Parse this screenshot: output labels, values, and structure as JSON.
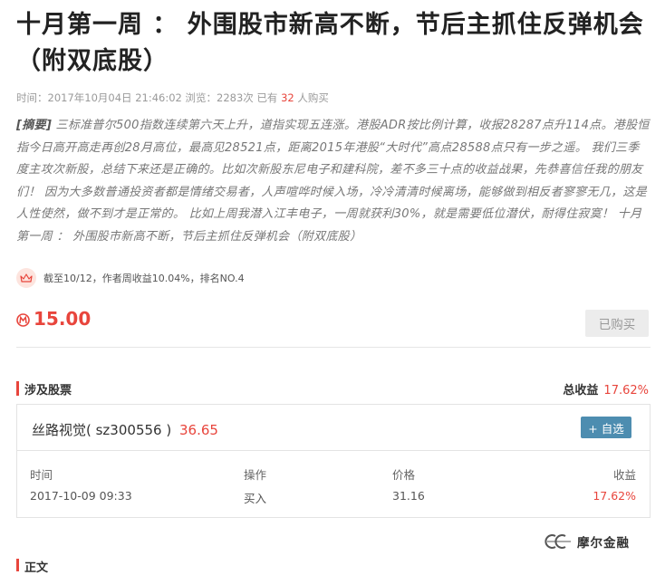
{
  "article": {
    "title": "十月第一周 ： 外围股市新高不断，节后主抓住反弹机会（附双底股）",
    "meta": {
      "time_label": "时间：",
      "time": "2017年10月04日 21:46:02",
      "views_label": "浏览：",
      "views": "2283次",
      "bought_prefix": "已有",
      "bought_count": "32",
      "bought_suffix": "人购买"
    },
    "summary_label": "[摘要]",
    "summary_text": " 三标准普尔500指数连续第六天上升，道指实现五连涨。港股ADR按比例计算，收报28287点升114点。港股恒指今日高开高走再创28月高位，最高见28521点，距离2015年港股“大时代”高点28588点只有一步之遥。 我们三季度主攻次新股，总结下来还是正确的。比如次新股东尼电子和建科院，差不多三十点的收益战果，先恭喜信任我的朋友们！ 因为大多数普通投资者都是情绪交易者，人声喧哗时候入场，冷冷清清时候离场，能够做到相反者寥寥无几，这是人性使然，做不到才是正常的。 比如上周我潜入江丰电子，一周就获利30%，就是需要低位潜伏，耐得住寂寞！ 十月第一周 ： 外围股市新高不断，节后主抓住反弹机会（附双底股）",
    "rank_text": "截至10/12，作者周收益10.04%，排名NO.4",
    "price": "15.00",
    "bought_button": "已购买"
  },
  "stocks_section": {
    "title": "涉及股票",
    "total_label": "总收益",
    "total_value": "17.62%",
    "stock": {
      "name": "丝路视觉( sz300556 )",
      "price": "36.65",
      "add_button": "+ 自选"
    },
    "columns": [
      "时间",
      "操作",
      "价格",
      "收益"
    ],
    "rows": [
      {
        "time": "2017-10-09 09:33",
        "action": "买入",
        "price": "31.16",
        "gain": "17.62%"
      }
    ]
  },
  "next_section": {
    "title": "正文"
  },
  "watermark": {
    "text": "摩尔金融"
  },
  "colors": {
    "accent": "#e8453c",
    "button_blue": "#4d8db0",
    "muted": "#9a9a9a"
  },
  "icons": [
    "crown-icon",
    "coin-icon",
    "watermark-logo-icon"
  ]
}
